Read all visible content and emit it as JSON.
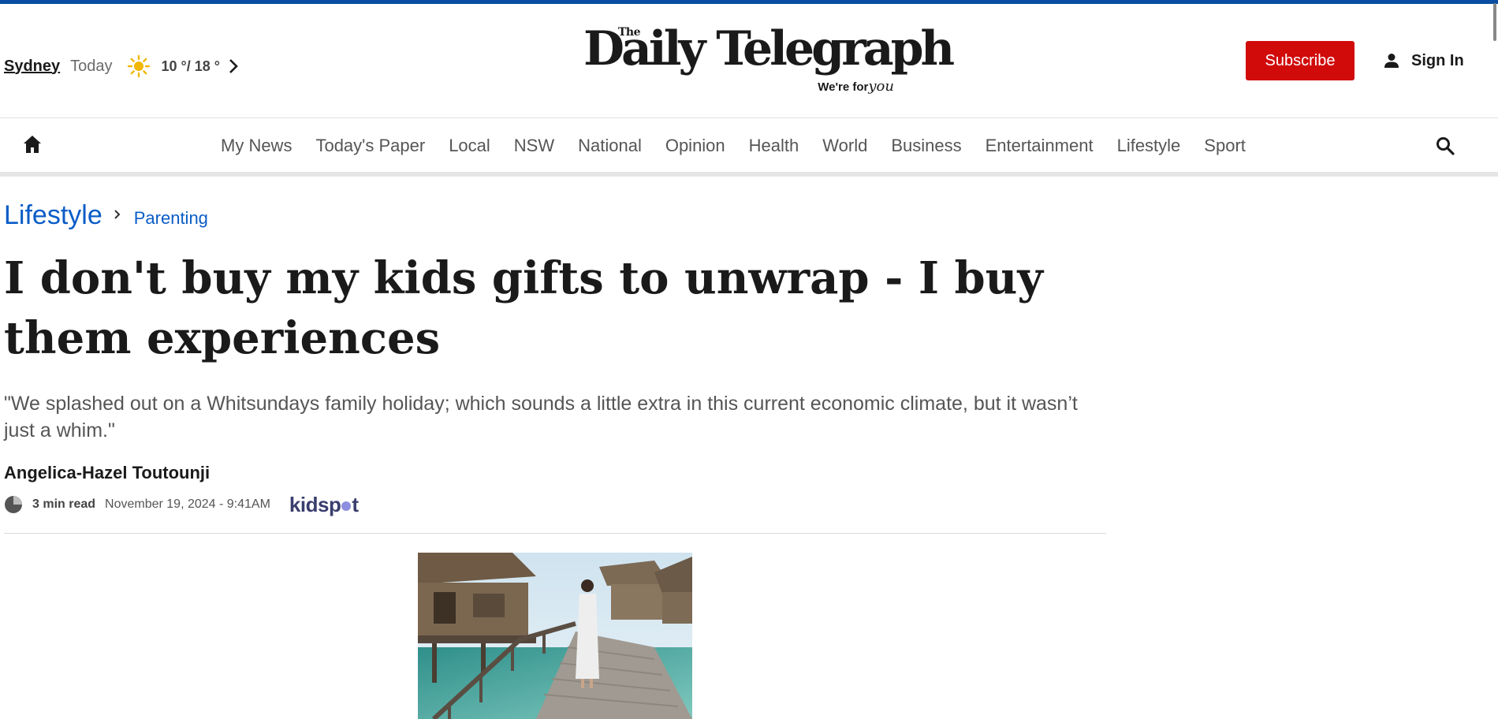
{
  "weather": {
    "city": "Sydney",
    "day": "Today",
    "temps": "10 °/ 18 °",
    "icon": "sun-icon"
  },
  "logo": {
    "the": "The",
    "name": "Daily Telegraph",
    "tagline_prefix": "We're for",
    "tagline_script": "you"
  },
  "header": {
    "subscribe_label": "Subscribe",
    "signin_label": "Sign In"
  },
  "nav": {
    "items": [
      "My News",
      "Today's Paper",
      "Local",
      "NSW",
      "National",
      "Opinion",
      "Health",
      "World",
      "Business",
      "Entertainment",
      "Lifestyle",
      "Sport"
    ]
  },
  "article": {
    "section": "Lifestyle",
    "subsection": "Parenting",
    "headline": "I don't buy my kids gifts to unwrap - I buy them experiences",
    "standfirst": "\"We splashed out on a Whitsundays family holiday; which sounds a little extra in this current economic climate, but it wasn’t just a whim.\"",
    "author": "Angelica-Hazel Toutounji",
    "read_time": "3 min read",
    "date": "November 19, 2024 - 9:41AM",
    "brand_part1": "kidsp",
    "brand_part2": "t"
  },
  "colors": {
    "accent_blue": "#0a5cc7",
    "subscribe_red": "#d10a0a",
    "topbar": "#0a4ea3"
  }
}
